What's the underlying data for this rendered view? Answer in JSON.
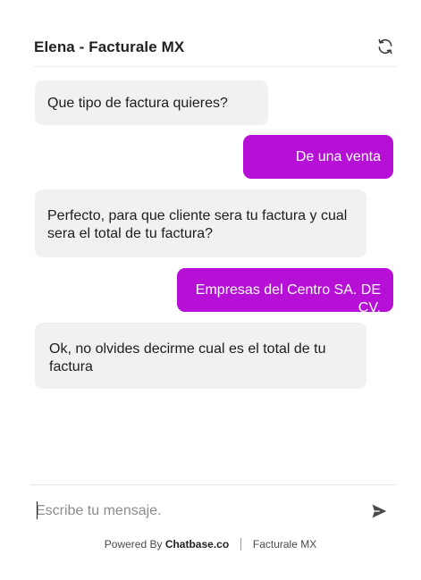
{
  "header": {
    "title": "Elena - Facturale MX",
    "refresh_icon": "refresh-icon"
  },
  "messages": [
    {
      "role": "bot",
      "text": "Que tipo de factura quieres?"
    },
    {
      "role": "user",
      "text": "De una venta"
    },
    {
      "role": "bot",
      "text": "Perfecto, para que cliente sera tu factura y cual sera el total de tu factura?"
    },
    {
      "role": "user",
      "text": "Empresas del Centro SA. DE CV."
    },
    {
      "role": "bot",
      "text": "Ok, no olvides decirme cual es el total de tu factura"
    }
  ],
  "composer": {
    "placeholder": "Escribe tu mensaje.",
    "value": "",
    "send_icon": "send-icon"
  },
  "footer": {
    "powered_by": "Powered By",
    "brand": "Chatbase.co",
    "company": "Facturale MX"
  },
  "colors": {
    "user_bubble": "#b60fd6",
    "bot_bubble": "#f1f1f0",
    "background": "#ffffff"
  }
}
